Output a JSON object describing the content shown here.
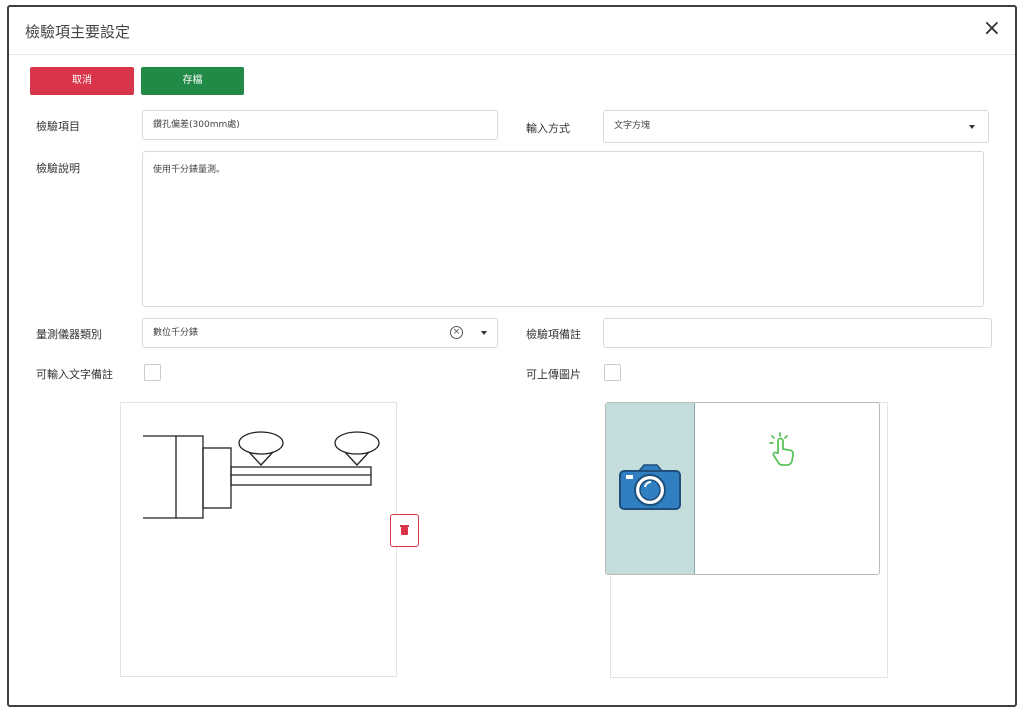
{
  "dialog": {
    "title": "檢驗項主要設定",
    "close": "×"
  },
  "buttons": {
    "cancel": "取消",
    "save": "存檔"
  },
  "form": {
    "item_label": "檢驗項目",
    "item_value": "鑽孔偏差(300mm處)",
    "input_mode_label": "輸入方式",
    "input_mode_value": "文字方塊",
    "description_label": "檢驗說明",
    "description_value": "使用千分錶量測。",
    "instrument_label": "量測儀器類別",
    "instrument_value": "數位千分錶",
    "remark_label": "檢驗項備註",
    "remark_value": "",
    "text_remark_label": "可輸入文字備註",
    "upload_image_label": "可上傳圖片"
  },
  "colors": {
    "cancel": "#d8344a",
    "save": "#228a47",
    "camera_bg": "#c4dcdc",
    "camera_icon": "#2f7fc1",
    "tap_icon": "#5cc25c"
  },
  "icons": {
    "close": "close-icon",
    "clear": "clear-icon",
    "dropdown": "chevron-down-icon",
    "delete": "trash-icon",
    "camera": "camera-icon",
    "tap": "tap-hand-icon"
  }
}
